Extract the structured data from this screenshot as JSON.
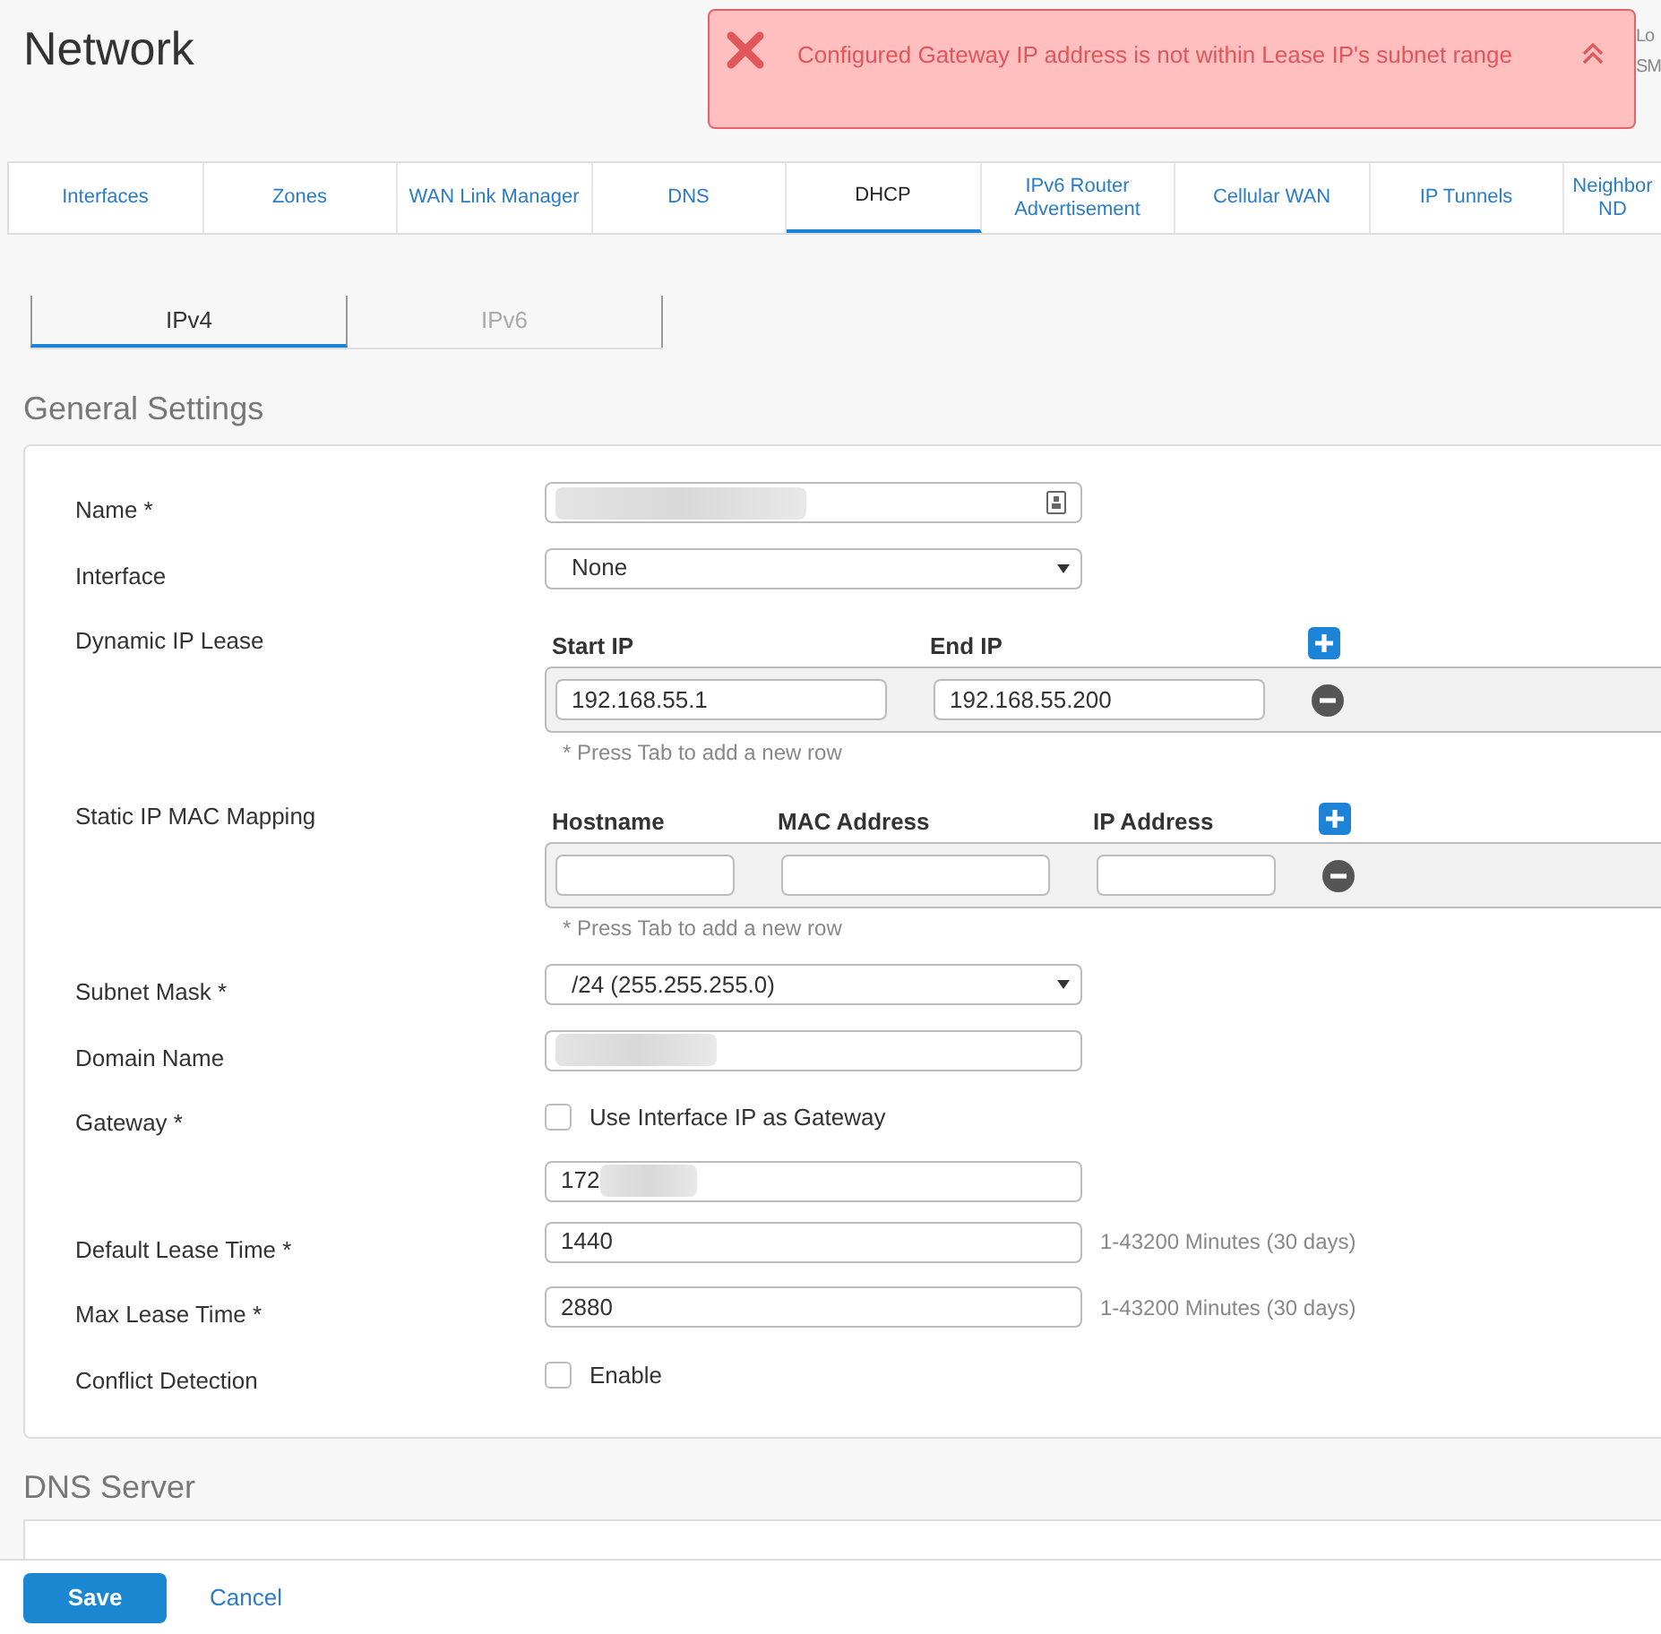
{
  "page_title": "Network",
  "alert": {
    "kind": "error",
    "message": "Configured Gateway IP address is not within Lease IP's subnet range"
  },
  "header_links": [
    "Lo",
    "SM"
  ],
  "tabs": [
    {
      "label": "Interfaces",
      "selected": false
    },
    {
      "label": "Zones",
      "selected": false
    },
    {
      "label": "WAN Link Manager",
      "selected": false
    },
    {
      "label": "DNS",
      "selected": false
    },
    {
      "label": "DHCP",
      "selected": true
    },
    {
      "label": "IPv6 Router Advertisement",
      "selected": false
    },
    {
      "label": "Cellular WAN",
      "selected": false
    },
    {
      "label": "IP Tunnels",
      "selected": false
    },
    {
      "label": "Neighbor ND",
      "selected": false
    }
  ],
  "sub_tabs": [
    {
      "label": "IPv4",
      "selected": true
    },
    {
      "label": "IPv6",
      "selected": false
    }
  ],
  "general_settings": {
    "title": "General Settings",
    "fields": [
      {
        "kind": "text",
        "label": "Name *",
        "redacted": true,
        "has_icon": true
      },
      {
        "kind": "select",
        "label": "Interface",
        "value": "None"
      },
      {
        "kind": "range",
        "label": "Dynamic IP Lease",
        "columns": [
          "Start IP",
          "End IP"
        ],
        "rows": [
          [
            "192.168.55.1",
            "192.168.55.200"
          ]
        ],
        "note": "* Press Tab to add a new row"
      },
      {
        "kind": "mapping",
        "label": "Static IP MAC Mapping",
        "columns": [
          "Hostname",
          "MAC Address",
          "IP Address"
        ],
        "note": "* Press Tab to add a new row"
      },
      {
        "kind": "select",
        "label": "Subnet Mask *",
        "value": "/24 (255.255.255.0)"
      },
      {
        "kind": "text",
        "label": "Domain Name",
        "redacted": true
      },
      {
        "kind": "checkbox",
        "label": "Gateway *",
        "option": "Use Interface IP as Gateway",
        "checked": false
      },
      {
        "kind": "text",
        "value": "172",
        "redacted": true
      },
      {
        "kind": "text",
        "label": "Default Lease Time *",
        "value": "1440",
        "hint": "1-43200 Minutes (30 days)"
      },
      {
        "kind": "text",
        "label": "Max Lease Time *",
        "value": "2880",
        "hint": "1-43200 Minutes (30 days)"
      },
      {
        "kind": "checkbox",
        "label": "Conflict Detection",
        "option": "Enable",
        "checked": false
      }
    ]
  },
  "dns_server": {
    "title": "DNS Server"
  },
  "footer": {
    "save": "Save",
    "cancel": "Cancel"
  }
}
